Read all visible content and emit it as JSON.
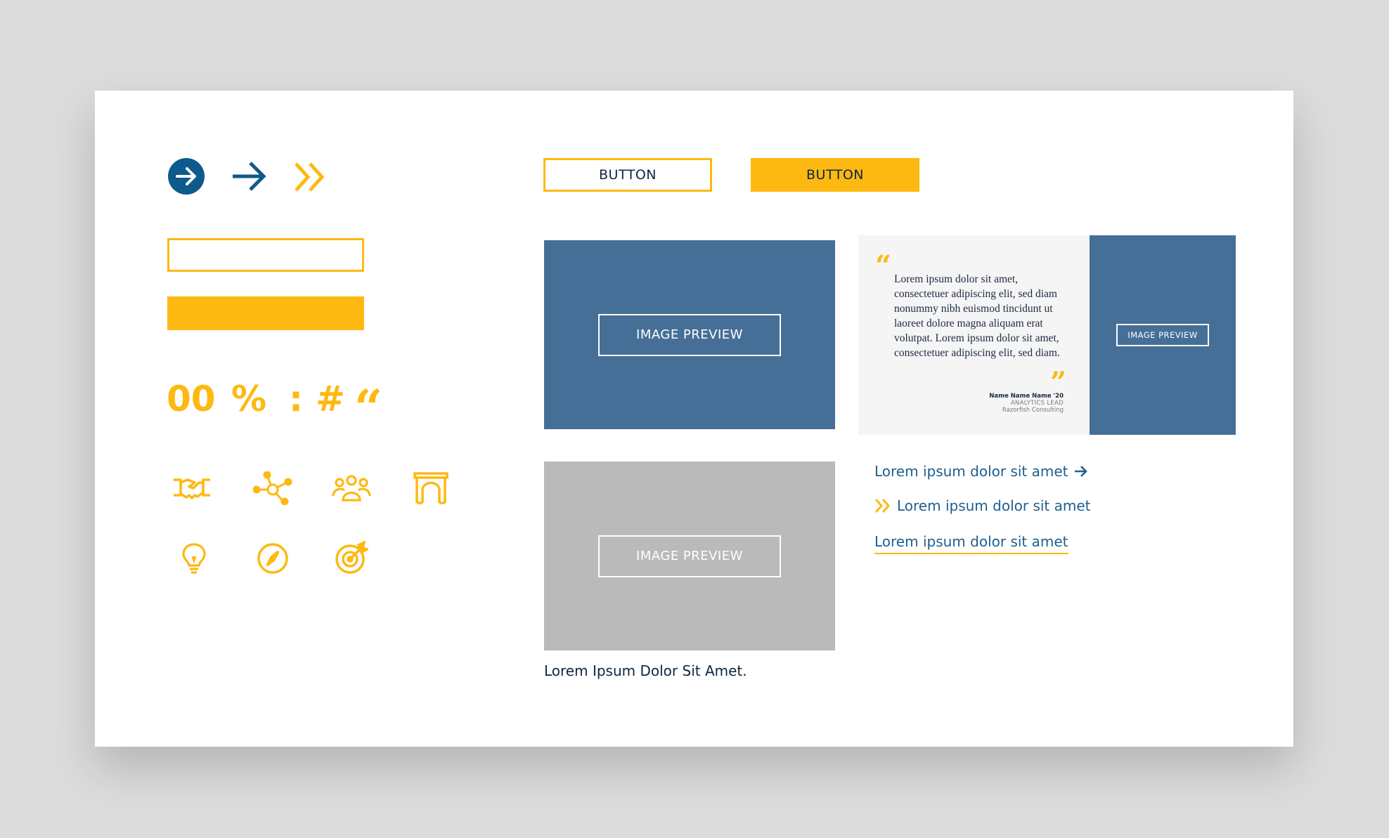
{
  "colors": {
    "brand_blue": "#0f5a8c",
    "brand_yellow": "#fdb912",
    "preview_blue": "#466f97",
    "preview_gray": "#bababa",
    "link_blue": "#1f5f8f",
    "navy_text": "#0f2540"
  },
  "arrows": {
    "circle_icon": "arrow-right-circle",
    "plain_icon": "arrow-right",
    "chevron_icon": "double-chevron-right"
  },
  "glyphs": {
    "zero": "00",
    "percent": "%",
    "colon": ":",
    "hash": "#",
    "quote": "66"
  },
  "icons": [
    "handshake-icon",
    "network-icon",
    "team-icon",
    "arch-icon",
    "lightbulb-icon",
    "compass-icon",
    "target-icon"
  ],
  "buttons": {
    "outline_label": "BUTTON",
    "filled_label": "BUTTON"
  },
  "preview_large": {
    "label": "IMAGE PREVIEW"
  },
  "preview_gray": {
    "label": "IMAGE PREVIEW",
    "caption": "Lorem Ipsum Dolor Sit Amet."
  },
  "quote_card": {
    "text": "Lorem ipsum dolor sit amet, consectetuer adipiscing elit, sed diam nonummy nibh euismod tincidunt ut laoreet dolore magna aliquam erat volutpat. Lorem ipsum dolor sit amet, consectetuer adipiscing elit, sed diam.",
    "name": "Name Name Name '20",
    "role": "ANALYTICS LEAD",
    "company": "Razorfish Consulting",
    "image_label": "IMAGE PREVIEW"
  },
  "links": {
    "arrow_link": "Lorem ipsum dolor sit amet",
    "chevron_link": "Lorem ipsum dolor sit amet",
    "underline_link": "Lorem ipsum dolor sit amet"
  }
}
